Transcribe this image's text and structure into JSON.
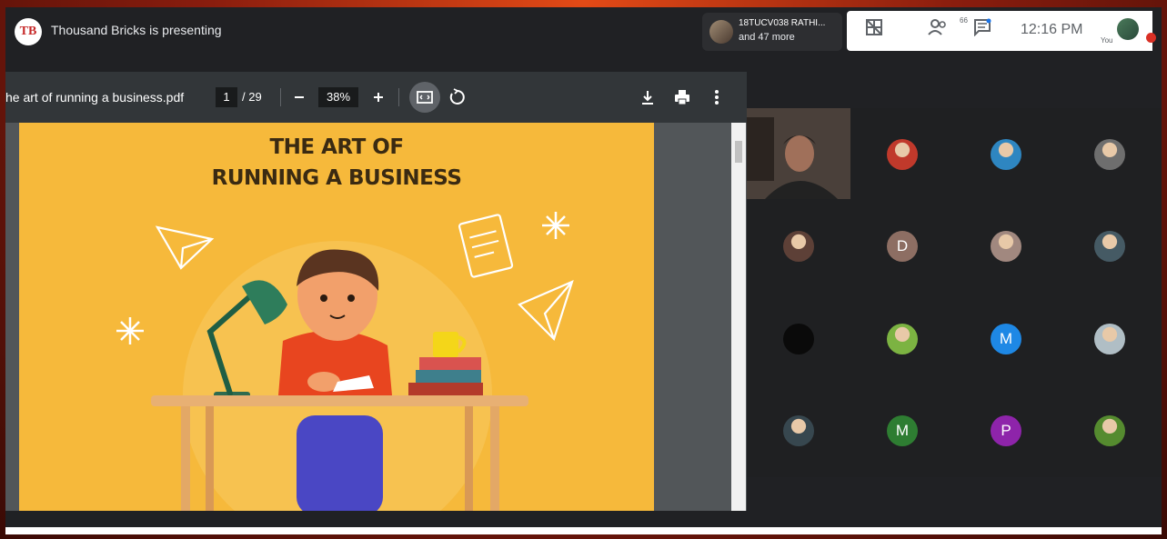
{
  "meeting": {
    "presenting_text": "Thousand Bricks is presenting",
    "presenter_logo": "TB",
    "participant_chip": {
      "name": "18TUCV038 RATHI...",
      "more": "and 47 more"
    },
    "participant_count": "66",
    "clock": "12:16 PM",
    "you_label": "You",
    "icons": [
      "layout-icon",
      "people-icon",
      "chat-icon"
    ]
  },
  "pdf": {
    "filename": "he art of running a business.pdf",
    "page": "1",
    "page_total": "/ 29",
    "zoom": "38%",
    "slide_title_line1": "THE ART OF",
    "slide_title_line2": "RUNNING A BUSINESS"
  },
  "grid": {
    "tiles": [
      {
        "type": "video"
      },
      {
        "type": "photo",
        "color": "#c0392b"
      },
      {
        "type": "photo",
        "color": "#2e86c1"
      },
      {
        "type": "photo",
        "color": "#6e6e6e"
      },
      {
        "type": "photo",
        "color": "#5d4037"
      },
      {
        "type": "letter",
        "letter": "D",
        "color": "#8d6e63"
      },
      {
        "type": "photo",
        "color": "#a1887f"
      },
      {
        "type": "photo",
        "color": "#455a64"
      },
      {
        "type": "blank",
        "color": "#0a0a0a"
      },
      {
        "type": "photo",
        "color": "#7cb342"
      },
      {
        "type": "letter",
        "letter": "M",
        "color": "#1e88e5"
      },
      {
        "type": "photo",
        "color": "#b0bec5"
      },
      {
        "type": "photo",
        "color": "#37474f"
      },
      {
        "type": "letter",
        "letter": "M",
        "color": "#2e7d32"
      },
      {
        "type": "letter",
        "letter": "P",
        "color": "#8e24aa"
      },
      {
        "type": "photo",
        "color": "#558b2f"
      }
    ]
  }
}
